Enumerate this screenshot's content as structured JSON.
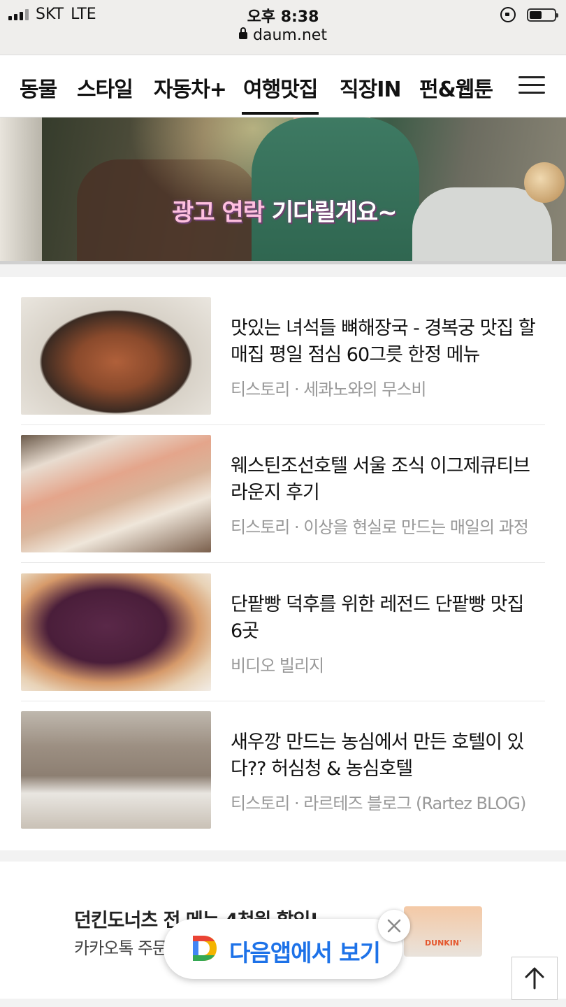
{
  "status_bar": {
    "carrier": "SKT",
    "network": "LTE",
    "time": "오후 8:38",
    "url": "daum.net",
    "battery_level": 0.5
  },
  "nav": {
    "tabs": [
      {
        "label": "동물",
        "active": false
      },
      {
        "label": "스타일",
        "active": false
      },
      {
        "label": "자동차+",
        "active": false
      },
      {
        "label": "여행맛집",
        "active": true
      },
      {
        "label": "직장IN",
        "active": false
      },
      {
        "label": "펀&웹툰",
        "active": false
      }
    ],
    "menu_icon": "hamburger-menu-icon"
  },
  "banner": {
    "caption_highlight": "광고 연락",
    "caption_rest": "기다릴게요~"
  },
  "articles": [
    {
      "title": "맛있는 녀석들 뼈해장국 - 경복궁 맛집 할매집 평일 점심 60그릇 한정 메뉴",
      "source": "티스토리 · 세콰노와의 무스비"
    },
    {
      "title": "웨스틴조선호텔 서울 조식 이그제큐티브 라운지 후기",
      "source": "티스토리 · 이상을 현실로 만드는 매일의 과정"
    },
    {
      "title": "단팥빵 덕후를 위한 레전드 단팥빵 맛집 6곳",
      "source": "비디오 빌리지"
    },
    {
      "title": "새우깡 만드는 농심에서 만든 호텔이 있다?? 허심청 & 농심호텔",
      "source": "티스토리 · 라르테즈 블로그 (Rartez BLOG)"
    }
  ],
  "ad": {
    "title": "던킨도너츠 전 메뉴 4천원 할인!",
    "subtitle": "카카오톡 주문",
    "brand": "DUNKIN'"
  },
  "app_banner": {
    "label": "다음앱에서 보기"
  },
  "colors": {
    "accent_blue": "#1d72e8",
    "text_primary": "#111111",
    "text_secondary": "#999999"
  }
}
